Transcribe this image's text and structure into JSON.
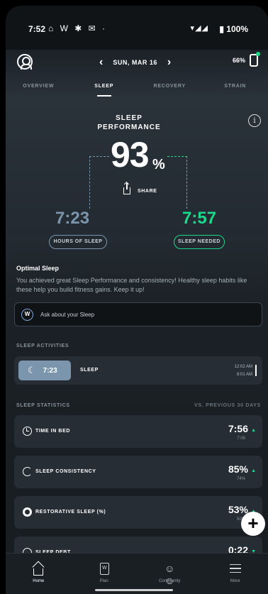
{
  "status_bar": {
    "time": "7:52",
    "icons": "⌂ W ✱ ✉ ·",
    "network": "▾◢◢",
    "battery": "▮ 100%"
  },
  "header": {
    "date": "SUN, MAR 16",
    "prev_icon": "chevron-left-icon",
    "next_icon": "chevron-right-icon",
    "device_battery": "66%"
  },
  "tabs": [
    "OVERVIEW",
    "SLEEP",
    "RECOVERY",
    "STRAIN"
  ],
  "performance": {
    "title_line1": "SLEEP",
    "title_line2": "PERFORMANCE",
    "value": "93",
    "unit": "%",
    "share_label": "SHARE",
    "hours_of_sleep": "7:23",
    "hours_label": "HOURS OF SLEEP",
    "sleep_needed": "7:57",
    "needed_label": "SLEEP NEEDED"
  },
  "insight": {
    "title": "Optimal Sleep",
    "body": "You achieved great Sleep Performance and consistency! Healthy sleep habits like these help you build fitness gains. Keep it up!",
    "ask_placeholder": "Ask about your Sleep",
    "ask_icon_letter": "W"
  },
  "activities": {
    "label": "SLEEP ACTIVITIES",
    "item": {
      "duration": "7:23",
      "type": "SLEEP",
      "start": "12:02 AM",
      "end": "8:01 AM"
    }
  },
  "statistics": {
    "label": "SLEEP STATISTICS",
    "compare_label": "VS. PREVIOUS 30 DAYS",
    "cards": [
      {
        "label": "TIME IN BED",
        "value": "7:56",
        "prev": "7:08",
        "trend": "up"
      },
      {
        "label": "SLEEP CONSISTENCY",
        "value": "85%",
        "prev": "74%",
        "trend": "up"
      },
      {
        "label": "RESTORATIVE SLEEP (%)",
        "value": "53%",
        "prev": "50%",
        "trend": "up"
      },
      {
        "label": "SLEEP DEBT",
        "value": "0:22",
        "prev": "",
        "trend": "down"
      }
    ]
  },
  "fab": "+",
  "nav": [
    {
      "label": "Home",
      "icon": "home-icon"
    },
    {
      "label": "Plan",
      "icon": "plan-icon"
    },
    {
      "label": "Community",
      "icon": "community-icon"
    },
    {
      "label": "More",
      "icon": "menu-icon"
    }
  ],
  "colors": {
    "sleep_blue": "#7a95ac",
    "whoop_green": "#1bd98b",
    "card_bg": "#262d34"
  }
}
